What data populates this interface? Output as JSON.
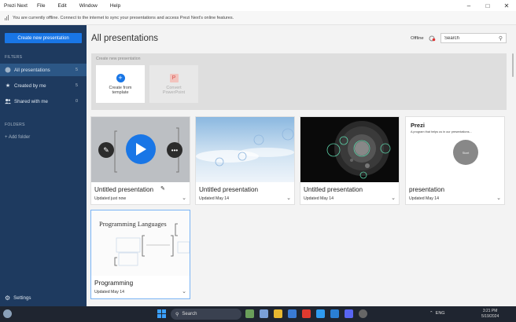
{
  "window": {
    "app_title": "Prezi Next",
    "menu": [
      "File",
      "Edit",
      "Window",
      "Help"
    ]
  },
  "banner": {
    "text": "You are currently offline. Connect to the internet to sync your presentations and access Prezi Next's online features."
  },
  "sidebar": {
    "create_label": "Create new presentation",
    "filters_heading": "FILTERS",
    "items": [
      {
        "label": "All presentations",
        "count": "5"
      },
      {
        "label": "Created by me",
        "count": "5"
      },
      {
        "label": "Shared with me",
        "count": "0"
      }
    ],
    "folders_heading": "FOLDERS",
    "add_folder": "+ Add folder",
    "settings_label": "Settings"
  },
  "header": {
    "title": "All presentations",
    "offline_label": "Offline",
    "search_placeholder": "Search"
  },
  "new_section": {
    "label": "Create new presentation",
    "tiles": [
      {
        "label": "Create from template",
        "icon": "plus-icon",
        "enabled": true
      },
      {
        "label": "Convert PowerPoint",
        "icon": "powerpoint-icon",
        "enabled": false
      }
    ]
  },
  "presentations": [
    {
      "name": "Untitled presentation",
      "updated": "Updated just now"
    },
    {
      "name": "Untitled presentation",
      "updated": "Updated May 14"
    },
    {
      "name": "Untitled presentation",
      "updated": "Updated May 14"
    },
    {
      "name": "presentation",
      "updated": "Updated May 14",
      "thumb_title": "Prezi",
      "thumb_text": "A program that helps us in our presentations...",
      "thumb_circle": "Start"
    },
    {
      "name": "Programming",
      "updated": "Updated May 14",
      "thumb_title": "Programming Languages"
    }
  ],
  "taskbar": {
    "search_label": "Search",
    "language": "ENG",
    "time": "3:21 PM",
    "date": "5/19/2024"
  },
  "colors": {
    "sidebar_bg": "#1e3a5f",
    "accent": "#1976e6",
    "active_item": "#2c5786"
  }
}
